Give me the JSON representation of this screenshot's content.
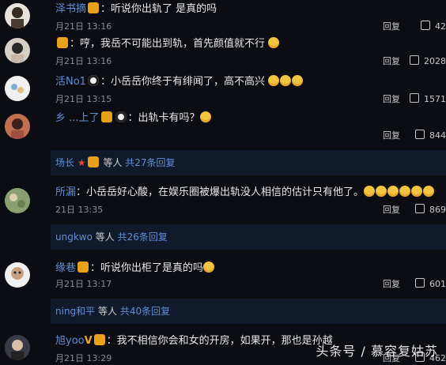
{
  "comments": [
    {
      "name": "泽书摘",
      "text": "：听说你出轨了 是真的吗",
      "time": "月21日 13:16",
      "reply": "回复",
      "likes": "42"
    },
    {
      "name": "",
      "text": "：哼，我岳不可能出到轨，首先颜值就不行",
      "time": "月21日 13:16",
      "reply": "回复",
      "likes": "2028"
    },
    {
      "name": "活No1",
      "text": "：小岳岳你终于有绯闻了，高不高兴",
      "time": "月21日 13:15",
      "reply": "回复",
      "likes": "1571"
    },
    {
      "name": "乡 ...上了",
      "text": "：出轨卡有吗？",
      "time": "",
      "reply": "回复",
      "likes": "844"
    },
    {
      "name": "所漏",
      "text": "：小岳岳好心酸，在娱乐圈被爆出轨没人相信的估计只有他了。",
      "time": "21日 13:35",
      "reply": "回复",
      "likes": "869"
    },
    {
      "name": "缘巷",
      "text": "：听说你出柜了是真的吗",
      "time": "月21日 13:17",
      "reply": "回复",
      "likes": "601"
    },
    {
      "name": "旭yoo",
      "text": "：我不相信你会和女的开房，如果开，那也是孙越",
      "time": "月21日 13:29",
      "reply": "回复",
      "likes": "462"
    }
  ],
  "subreplies": [
    {
      "user": "场长",
      "mid": "等人",
      "link": "共27条回复"
    },
    {
      "user": "ungkwo",
      "mid": "等人",
      "link": "共26条回复"
    },
    {
      "user": "ning和平",
      "mid": "等人",
      "link": "共40条回复"
    }
  ],
  "watermark": "头条号 / 慕容复姑苏"
}
